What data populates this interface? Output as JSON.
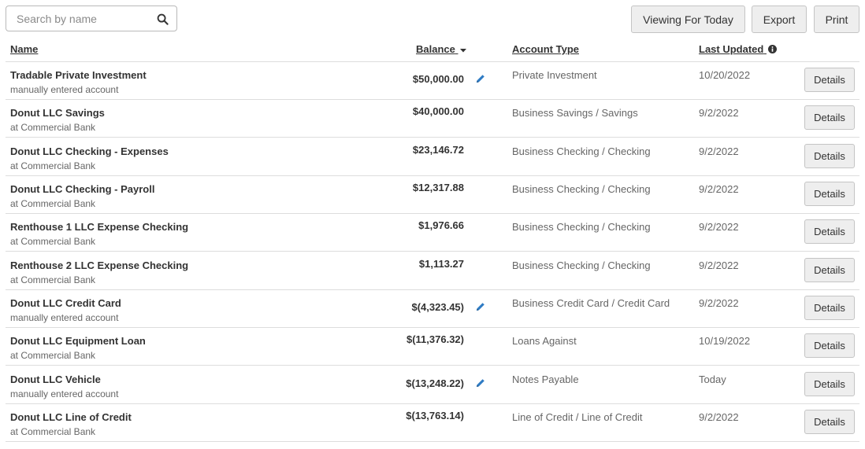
{
  "search": {
    "placeholder": "Search by name",
    "value": ""
  },
  "toolbar": {
    "viewing_label": "Viewing For Today",
    "export_label": "Export",
    "print_label": "Print"
  },
  "columns": {
    "name": "Name",
    "balance": "Balance",
    "account_type": "Account Type",
    "last_updated": "Last Updated"
  },
  "details_label": "Details",
  "accounts": [
    {
      "name": "Tradable Private Investment",
      "sub": "manually entered account",
      "balance": "$50,000.00",
      "editable": true,
      "type": "Private Investment",
      "updated": "10/20/2022"
    },
    {
      "name": "Donut LLC Savings",
      "sub": "at Commercial Bank",
      "balance": "$40,000.00",
      "editable": false,
      "type": "Business Savings / Savings",
      "updated": "9/2/2022"
    },
    {
      "name": "Donut LLC Checking - Expenses",
      "sub": "at Commercial Bank",
      "balance": "$23,146.72",
      "editable": false,
      "type": "Business Checking / Checking",
      "updated": "9/2/2022"
    },
    {
      "name": "Donut LLC Checking - Payroll",
      "sub": "at Commercial Bank",
      "balance": "$12,317.88",
      "editable": false,
      "type": "Business Checking / Checking",
      "updated": "9/2/2022"
    },
    {
      "name": "Renthouse 1 LLC Expense Checking",
      "sub": "at Commercial Bank",
      "balance": "$1,976.66",
      "editable": false,
      "type": "Business Checking / Checking",
      "updated": "9/2/2022"
    },
    {
      "name": "Renthouse 2 LLC Expense Checking",
      "sub": "at Commercial Bank",
      "balance": "$1,113.27",
      "editable": false,
      "type": "Business Checking / Checking",
      "updated": "9/2/2022"
    },
    {
      "name": "Donut LLC Credit Card",
      "sub": "manually entered account",
      "balance": "$(4,323.45)",
      "editable": true,
      "type": "Business Credit Card / Credit Card",
      "updated": "9/2/2022"
    },
    {
      "name": "Donut LLC Equipment Loan",
      "sub": "at Commercial Bank",
      "balance": "$(11,376.32)",
      "editable": false,
      "type": "Loans Against",
      "updated": "10/19/2022"
    },
    {
      "name": "Donut LLC Vehicle",
      "sub": "manually entered account",
      "balance": "$(13,248.22)",
      "editable": true,
      "type": "Notes Payable",
      "updated": "Today"
    },
    {
      "name": "Donut LLC Line of Credit",
      "sub": "at Commercial Bank",
      "balance": "$(13,763.14)",
      "editable": false,
      "type": "Line of Credit / Line of Credit",
      "updated": "9/2/2022"
    }
  ],
  "colors": {
    "pencil": "#2e7bc4",
    "button_bg": "#eeeeee",
    "border": "#dddddd"
  },
  "icons": {
    "search": "search-icon",
    "sort": "sort-desc-icon",
    "info": "info-icon",
    "edit": "pencil-icon"
  }
}
